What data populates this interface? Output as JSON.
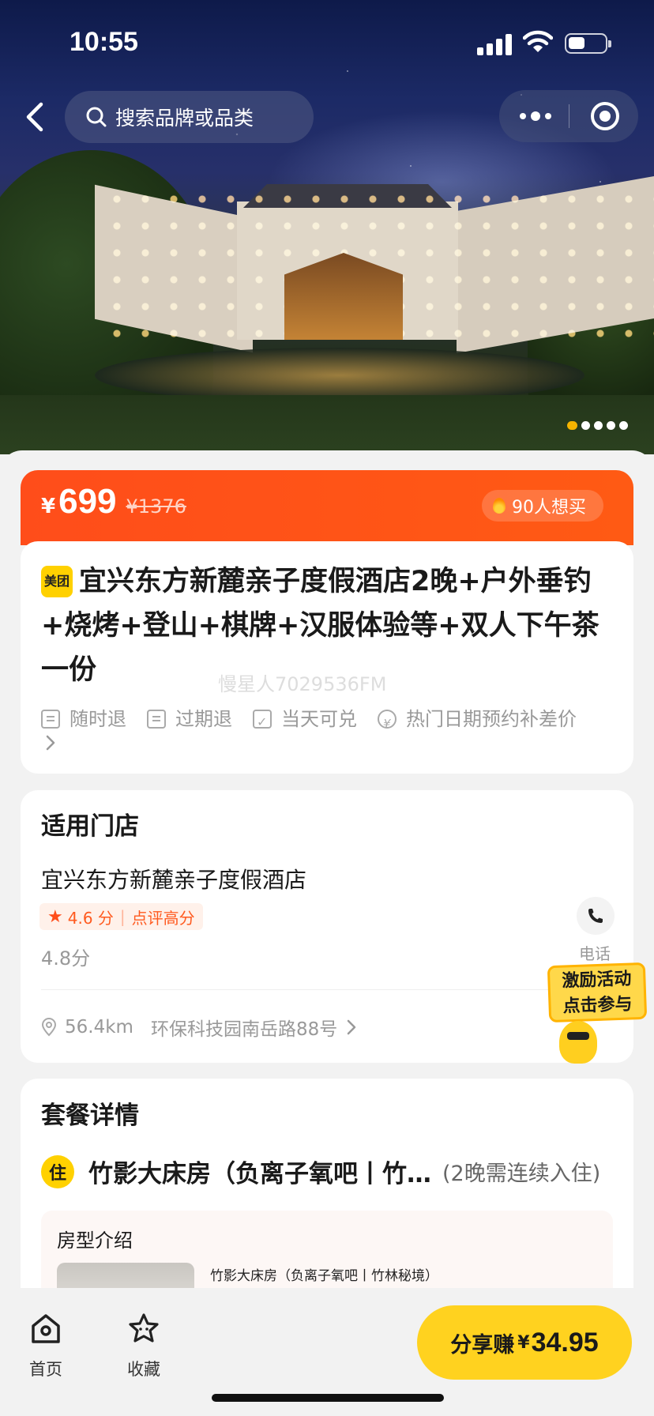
{
  "status_bar": {
    "time": "10:55"
  },
  "top_bar": {
    "search_placeholder": "搜索品牌或品类"
  },
  "gallery": {
    "total_images": 5,
    "current_index": 1
  },
  "price": {
    "currency": "¥",
    "current": "699",
    "original": "¥1376",
    "want_count": "90人想买"
  },
  "product": {
    "brand_badge": "美团",
    "title": "宜兴东方新麓亲子度假酒店2晚+户外垂钓+烧烤+登山+棋牌+汉服体验等+双人下午茶一份",
    "watermark": "慢星人7029536FM",
    "tags": [
      "随时退",
      "过期退",
      "当天可兑",
      "热门日期预约补差价"
    ]
  },
  "store": {
    "section_title": "适用门店",
    "name": "宜兴东方新麓亲子度假酒店",
    "rating": "4.6 分",
    "rating_note": "点评高分",
    "score": "4.8分",
    "phone_label": "电话",
    "distance": "56.4km",
    "address": "环保科技园南岳路88号"
  },
  "promo": {
    "line1": "激励活动",
    "line2": "点击参与"
  },
  "package": {
    "section_title": "套餐详情",
    "stay_badge": "住",
    "room_name": "竹影大床房（负离子氧吧丨竹林秘境）",
    "room_note": "(2晚需连续入住)",
    "intro_title": "房型介绍",
    "room_sub": "竹影大床房（负离子氧吧丨竹林秘境）"
  },
  "bottom_nav": {
    "home": "首页",
    "favorite": "收藏",
    "share_label": "分享赚",
    "share_currency": "¥",
    "share_amount": "34.95"
  },
  "colors": {
    "accent": "#ff4d1a",
    "yellow": "#ffd21f",
    "brand": "#ffd100"
  }
}
